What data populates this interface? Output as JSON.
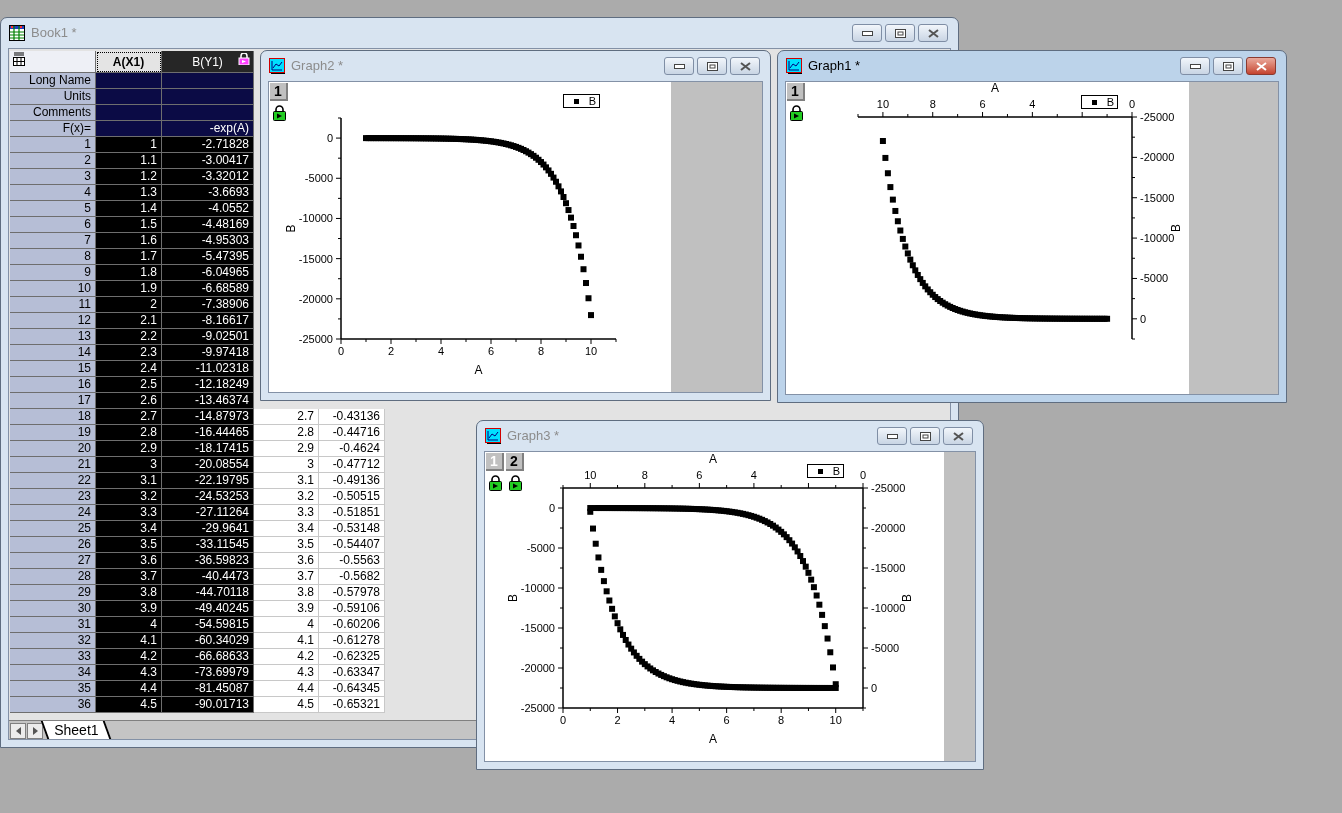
{
  "windows": [
    {
      "kind": "workbook",
      "title": "Book1 *",
      "active": false,
      "columns": [
        {
          "label": "A(X1)",
          "selected": true,
          "focused": true,
          "locked": false
        },
        {
          "label": "B(Y1)",
          "selected": true,
          "focused": false,
          "locked": true
        }
      ],
      "label_rows": [
        {
          "label": "Long Name"
        },
        {
          "label": "Units"
        },
        {
          "label": "Comments"
        },
        {
          "label": "F(x)=",
          "column_2": "-exp(A)"
        }
      ],
      "rows": [
        {
          "n": "1",
          "a": "1",
          "b": "-2.71828"
        },
        {
          "n": "2",
          "a": "1.1",
          "b": "-3.00417"
        },
        {
          "n": "3",
          "a": "1.2",
          "b": "-3.32012"
        },
        {
          "n": "4",
          "a": "1.3",
          "b": "-3.6693"
        },
        {
          "n": "5",
          "a": "1.4",
          "b": "-4.0552"
        },
        {
          "n": "6",
          "a": "1.5",
          "b": "-4.48169"
        },
        {
          "n": "7",
          "a": "1.6",
          "b": "-4.95303"
        },
        {
          "n": "8",
          "a": "1.7",
          "b": "-5.47395"
        },
        {
          "n": "9",
          "a": "1.8",
          "b": "-6.04965"
        },
        {
          "n": "10",
          "a": "1.9",
          "b": "-6.68589"
        },
        {
          "n": "11",
          "a": "2",
          "b": "-7.38906"
        },
        {
          "n": "12",
          "a": "2.1",
          "b": "-8.16617"
        },
        {
          "n": "13",
          "a": "2.2",
          "b": "-9.02501"
        },
        {
          "n": "14",
          "a": "2.3",
          "b": "-9.97418"
        },
        {
          "n": "15",
          "a": "2.4",
          "b": "-11.02318"
        },
        {
          "n": "16",
          "a": "2.5",
          "b": "-12.18249"
        },
        {
          "n": "17",
          "a": "2.6",
          "b": "-13.46374"
        },
        {
          "n": "18",
          "a": "2.7",
          "b": "-14.87973",
          "column_3": "2.7",
          "column_4": "-0.43136"
        },
        {
          "n": "19",
          "a": "2.8",
          "b": "-16.44465",
          "column_3": "2.8",
          "column_4": "-0.44716"
        },
        {
          "n": "20",
          "a": "2.9",
          "b": "-18.17415",
          "column_3": "2.9",
          "column_4": "-0.4624"
        },
        {
          "n": "21",
          "a": "3",
          "b": "-20.08554",
          "column_3": "3",
          "column_4": "-0.47712"
        },
        {
          "n": "22",
          "a": "3.1",
          "b": "-22.19795",
          "column_3": "3.1",
          "column_4": "-0.49136"
        },
        {
          "n": "23",
          "a": "3.2",
          "b": "-24.53253",
          "column_3": "3.2",
          "column_4": "-0.50515"
        },
        {
          "n": "24",
          "a": "3.3",
          "b": "-27.11264",
          "column_3": "3.3",
          "column_4": "-0.51851"
        },
        {
          "n": "25",
          "a": "3.4",
          "b": "-29.9641",
          "column_3": "3.4",
          "column_4": "-0.53148"
        },
        {
          "n": "26",
          "a": "3.5",
          "b": "-33.11545",
          "column_3": "3.5",
          "column_4": "-0.54407"
        },
        {
          "n": "27",
          "a": "3.6",
          "b": "-36.59823",
          "column_3": "3.6",
          "column_4": "-0.5563"
        },
        {
          "n": "28",
          "a": "3.7",
          "b": "-40.4473",
          "column_3": "3.7",
          "column_4": "-0.5682"
        },
        {
          "n": "29",
          "a": "3.8",
          "b": "-44.70118",
          "column_3": "3.8",
          "column_4": "-0.57978"
        },
        {
          "n": "30",
          "a": "3.9",
          "b": "-49.40245",
          "column_3": "3.9",
          "column_4": "-0.59106"
        },
        {
          "n": "31",
          "a": "4",
          "b": "-54.59815",
          "column_3": "4",
          "column_4": "-0.60206"
        },
        {
          "n": "32",
          "a": "4.1",
          "b": "-60.34029",
          "column_3": "4.1",
          "column_4": "-0.61278"
        },
        {
          "n": "33",
          "a": "4.2",
          "b": "-66.68633",
          "column_3": "4.2",
          "column_4": "-0.62325"
        },
        {
          "n": "34",
          "a": "4.3",
          "b": "-73.69979",
          "column_3": "4.3",
          "column_4": "-0.63347"
        },
        {
          "n": "35",
          "a": "4.4",
          "b": "-81.45087",
          "column_3": "4.4",
          "column_4": "-0.64345"
        },
        {
          "n": "36",
          "a": "4.5",
          "b": "-90.01713",
          "column_3": "4.5",
          "column_4": "-0.65321"
        }
      ],
      "sheet_tabs": [
        {
          "label": "Sheet1",
          "selected": true
        }
      ]
    },
    {
      "kind": "graph",
      "title": "Graph2 *",
      "active": false,
      "layers": [
        {
          "label": "1",
          "selected": true,
          "kind": "standard",
          "chart_data": {
            "type": "scatter",
            "xlabel": "A",
            "ylabel": "B",
            "x": [
              1,
              1.1,
              1.2,
              1.3,
              1.4,
              1.5,
              1.6,
              1.7,
              1.8,
              1.9,
              2,
              2.1,
              2.2,
              2.3,
              2.4,
              2.5,
              2.6,
              2.7,
              2.8,
              2.9,
              3,
              3.1,
              3.2,
              3.3,
              3.4,
              3.5,
              3.6,
              3.7,
              3.8,
              3.9,
              4,
              4.1,
              4.2,
              4.3,
              4.4,
              4.5,
              4.6,
              4.7,
              4.8,
              4.9,
              5,
              5.1,
              5.2,
              5.3,
              5.4,
              5.5,
              5.6,
              5.7,
              5.8,
              5.9,
              6,
              6.1,
              6.2,
              6.3,
              6.4,
              6.5,
              6.6,
              6.7,
              6.8,
              6.9,
              7,
              7.1,
              7.2,
              7.3,
              7.4,
              7.5,
              7.6,
              7.7,
              7.8,
              7.9,
              8,
              8.1,
              8.2,
              8.3,
              8.4,
              8.5,
              8.6,
              8.7,
              8.8,
              8.9,
              9,
              9.1,
              9.2,
              9.3,
              9.4,
              9.5,
              9.6,
              9.7,
              9.8,
              9.9,
              10
            ],
            "series": [
              {
                "name": "B",
                "color": "#000000",
                "values": [
                  -3,
                  -3,
                  -3,
                  -4,
                  -4,
                  -4,
                  -5,
                  -5,
                  -6,
                  -7,
                  -7,
                  -8,
                  -9,
                  -10,
                  -11,
                  -12,
                  -13,
                  -15,
                  -16,
                  -18,
                  -20,
                  -22,
                  -25,
                  -27,
                  -30,
                  -33,
                  -37,
                  -40,
                  -45,
                  -49,
                  -55,
                  -60,
                  -67,
                  -74,
                  -81,
                  -90,
                  -99,
                  -110,
                  -122,
                  -134,
                  -148,
                  -164,
                  -181,
                  -200,
                  -221,
                  -245,
                  -270,
                  -299,
                  -330,
                  -365,
                  -403,
                  -446,
                  -493,
                  -545,
                  -602,
                  -665,
                  -735,
                  -812,
                  -898,
                  -992,
                  -1097,
                  -1212,
                  -1339,
                  -1480,
                  -1636,
                  -1808,
                  -1998,
                  -2208,
                  -2441,
                  -2697,
                  -2981,
                  -3294,
                  -3641,
                  -4024,
                  -4447,
                  -4915,
                  -5432,
                  -6003,
                  -6634,
                  -7332,
                  -8103,
                  -8955,
                  -9897,
                  -10938,
                  -12088,
                  -13360,
                  -14765,
                  -16318,
                  -18034,
                  -19930,
                  -22026
                ]
              }
            ],
            "xlim": [
              0,
              11
            ],
            "ylim": [
              -25000,
              2500
            ],
            "xticks": [
              {
                "value": 0,
                "label": "0"
              },
              {
                "value": 2,
                "label": "2"
              },
              {
                "value": 4,
                "label": "4"
              },
              {
                "value": 6,
                "label": "6"
              },
              {
                "value": 8,
                "label": "8"
              },
              {
                "value": 10,
                "label": "10"
              }
            ],
            "yticks": [
              {
                "value": -25000,
                "label": "-25000"
              },
              {
                "value": -20000,
                "label": "-20000"
              },
              {
                "value": -15000,
                "label": "-15000"
              },
              {
                "value": -10000,
                "label": "-10000"
              },
              {
                "value": -5000,
                "label": "-5000"
              },
              {
                "value": 0,
                "label": "0"
              }
            ]
          }
        }
      ]
    },
    {
      "kind": "graph",
      "title": "Graph1 *",
      "active": true,
      "layers": [
        {
          "label": "1",
          "selected": true,
          "kind": "reversed",
          "chart_data": {
            "type": "scatter",
            "xlabel": "A",
            "ylabel": "B",
            "x": [
              1,
              1.1,
              1.2,
              1.3,
              1.4,
              1.5,
              1.6,
              1.7,
              1.8,
              1.9,
              2,
              2.1,
              2.2,
              2.3,
              2.4,
              2.5,
              2.6,
              2.7,
              2.8,
              2.9,
              3,
              3.1,
              3.2,
              3.3,
              3.4,
              3.5,
              3.6,
              3.7,
              3.8,
              3.9,
              4,
              4.1,
              4.2,
              4.3,
              4.4,
              4.5,
              4.6,
              4.7,
              4.8,
              4.9,
              5,
              5.1,
              5.2,
              5.3,
              5.4,
              5.5,
              5.6,
              5.7,
              5.8,
              5.9,
              6,
              6.1,
              6.2,
              6.3,
              6.4,
              6.5,
              6.6,
              6.7,
              6.8,
              6.9,
              7,
              7.1,
              7.2,
              7.3,
              7.4,
              7.5,
              7.6,
              7.7,
              7.8,
              7.9,
              8,
              8.1,
              8.2,
              8.3,
              8.4,
              8.5,
              8.6,
              8.7,
              8.8,
              8.9,
              9,
              9.1,
              9.2,
              9.3,
              9.4,
              9.5,
              9.6,
              9.7,
              9.8,
              9.9,
              10
            ],
            "series": [
              {
                "name": "B",
                "color": "#000000",
                "values": [
                  -3,
                  -3,
                  -3,
                  -4,
                  -4,
                  -4,
                  -5,
                  -5,
                  -6,
                  -7,
                  -7,
                  -8,
                  -9,
                  -10,
                  -11,
                  -12,
                  -13,
                  -15,
                  -16,
                  -18,
                  -20,
                  -22,
                  -25,
                  -27,
                  -30,
                  -33,
                  -37,
                  -40,
                  -45,
                  -49,
                  -55,
                  -60,
                  -67,
                  -74,
                  -81,
                  -90,
                  -99,
                  -110,
                  -122,
                  -134,
                  -148,
                  -164,
                  -181,
                  -200,
                  -221,
                  -245,
                  -270,
                  -299,
                  -330,
                  -365,
                  -403,
                  -446,
                  -493,
                  -545,
                  -602,
                  -665,
                  -735,
                  -812,
                  -898,
                  -992,
                  -1097,
                  -1212,
                  -1339,
                  -1480,
                  -1636,
                  -1808,
                  -1998,
                  -2208,
                  -2441,
                  -2697,
                  -2981,
                  -3294,
                  -3641,
                  -4024,
                  -4447,
                  -4915,
                  -5432,
                  -6003,
                  -6634,
                  -7332,
                  -8103,
                  -8955,
                  -9897,
                  -10938,
                  -12088,
                  -13360,
                  -14765,
                  -16318,
                  -18034,
                  -19930,
                  -22026
                ]
              }
            ],
            "xlim": [
              11,
              0
            ],
            "ylim": [
              2500,
              -25000
            ],
            "xticks": [
              {
                "value": 10,
                "label": "10"
              },
              {
                "value": 8,
                "label": "8"
              },
              {
                "value": 6,
                "label": "6"
              },
              {
                "value": 4,
                "label": "4"
              },
              {
                "value": 0,
                "label": "0"
              }
            ],
            "yticks": [
              {
                "value": -25000,
                "label": "-25000"
              },
              {
                "value": -20000,
                "label": "-20000"
              },
              {
                "value": -15000,
                "label": "-15000"
              },
              {
                "value": -10000,
                "label": "-10000"
              },
              {
                "value": -5000,
                "label": "-5000"
              },
              {
                "value": 0,
                "label": "0"
              }
            ]
          }
        }
      ]
    },
    {
      "kind": "graph",
      "title": "Graph3 *",
      "active": false,
      "layers": [
        {
          "label": "1",
          "selected": false,
          "kind": "standard",
          "chart_data": {
            "type": "scatter",
            "xlabel": "A",
            "ylabel": "B",
            "x": [
              1,
              1.2,
              1.3,
              1.4,
              1.5,
              1.6,
              1.7,
              1.8,
              1.9,
              2,
              2.1,
              2.2,
              2.3,
              2.4,
              2.5,
              2.6,
              2.7,
              2.8,
              2.9,
              3,
              3.1,
              3.2,
              3.3,
              3.4,
              3.5,
              3.6,
              3.7,
              3.8,
              3.9,
              4,
              4.1,
              4.2,
              4.3,
              4.4,
              4.5,
              4.6,
              4.7,
              4.8,
              4.9,
              5,
              5.1,
              5.2,
              5.3,
              5.4,
              5.5,
              5.6,
              5.7,
              5.8,
              5.9,
              6,
              6.1,
              6.2,
              6.3,
              6.4,
              6.5,
              6.6,
              6.7,
              6.8,
              6.9,
              7,
              7.1,
              7.2,
              7.3,
              7.4,
              7.5,
              7.6,
              7.7,
              7.8,
              7.9,
              8,
              8.1,
              8.2,
              8.3,
              8.4,
              8.5,
              8.6,
              8.7,
              8.8,
              8.9,
              9,
              9.1,
              9.2,
              9.3,
              9.4,
              9.5,
              9.6,
              9.7,
              9.8,
              9.9,
              10
            ],
            "series": [
              {
                "name": "B",
                "color": "#000000",
                "values": [
                  -3,
                  -3,
                  -4,
                  -4,
                  -4,
                  -5,
                  -5,
                  -6,
                  -7,
                  -7,
                  -8,
                  -9,
                  -10,
                  -11,
                  -12,
                  -13,
                  -15,
                  -16,
                  -18,
                  -20,
                  -22,
                  -25,
                  -27,
                  -30,
                  -33,
                  -37,
                  -40,
                  -45,
                  -49,
                  -55,
                  -60,
                  -67,
                  -74,
                  -81,
                  -90,
                  -99,
                  -110,
                  -122,
                  -134,
                  -148,
                  -164,
                  -181,
                  -200,
                  -221,
                  -245,
                  -270,
                  -299,
                  -330,
                  -365,
                  -403,
                  -446,
                  -493,
                  -545,
                  -602,
                  -665,
                  -735,
                  -812,
                  -898,
                  -992,
                  -1097,
                  -1212,
                  -1339,
                  -1480,
                  -1636,
                  -1808,
                  -1998,
                  -2208,
                  -2441,
                  -2697,
                  -2981,
                  -3294,
                  -3641,
                  -4024,
                  -4447,
                  -4915,
                  -5432,
                  -6003,
                  -6634,
                  -7332,
                  -8103,
                  -8955,
                  -9897,
                  -10938,
                  -12088,
                  -13360,
                  -14765,
                  -16318,
                  -18034,
                  -19930,
                  -22026
                ]
              }
            ],
            "xlim": [
              0,
              11
            ],
            "ylim": [
              -25000,
              2500
            ],
            "xticks": [
              {
                "value": 0,
                "label": "0"
              },
              {
                "value": 2,
                "label": "2"
              },
              {
                "value": 4,
                "label": "4"
              },
              {
                "value": 6,
                "label": "6"
              },
              {
                "value": 8,
                "label": "8"
              },
              {
                "value": 10,
                "label": "10"
              }
            ],
            "yticks": [
              {
                "value": -25000,
                "label": "-25000"
              },
              {
                "value": -20000,
                "label": "-20000"
              },
              {
                "value": -15000,
                "label": "-15000"
              },
              {
                "value": -10000,
                "label": "-10000"
              },
              {
                "value": -5000,
                "label": "-5000"
              },
              {
                "value": 0,
                "label": "0"
              }
            ]
          }
        },
        {
          "label": "2",
          "selected": true,
          "kind": "reversed",
          "chart_data": {
            "type": "scatter",
            "xlabel": "A",
            "ylabel": "B",
            "x": [
              1,
              1.2,
              1.3,
              1.4,
              1.5,
              1.6,
              1.7,
              1.8,
              1.9,
              2,
              2.1,
              2.2,
              2.3,
              2.4,
              2.5,
              2.6,
              2.7,
              2.8,
              2.9,
              3,
              3.1,
              3.2,
              3.3,
              3.4,
              3.5,
              3.6,
              3.7,
              3.8,
              3.9,
              4,
              4.1,
              4.2,
              4.3,
              4.4,
              4.5,
              4.6,
              4.7,
              4.8,
              4.9,
              5,
              5.1,
              5.2,
              5.3,
              5.4,
              5.5,
              5.6,
              5.7,
              5.8,
              5.9,
              6,
              6.1,
              6.2,
              6.3,
              6.4,
              6.5,
              6.6,
              6.7,
              6.8,
              6.9,
              7,
              7.1,
              7.2,
              7.3,
              7.4,
              7.5,
              7.6,
              7.7,
              7.8,
              7.9,
              8,
              8.1,
              8.2,
              8.3,
              8.4,
              8.5,
              8.6,
              8.7,
              8.8,
              8.9,
              9,
              9.1,
              9.2,
              9.3,
              9.4,
              9.5,
              9.6,
              9.7,
              9.8,
              9.9,
              10
            ],
            "series": [
              {
                "color": "#000000",
                "values": [
                  -3,
                  -3,
                  -4,
                  -4,
                  -4,
                  -5,
                  -5,
                  -6,
                  -7,
                  -7,
                  -8,
                  -9,
                  -10,
                  -11,
                  -12,
                  -13,
                  -15,
                  -16,
                  -18,
                  -20,
                  -22,
                  -25,
                  -27,
                  -30,
                  -33,
                  -37,
                  -40,
                  -45,
                  -49,
                  -55,
                  -60,
                  -67,
                  -74,
                  -81,
                  -90,
                  -99,
                  -110,
                  -122,
                  -134,
                  -148,
                  -164,
                  -181,
                  -200,
                  -221,
                  -245,
                  -270,
                  -299,
                  -330,
                  -365,
                  -403,
                  -446,
                  -493,
                  -545,
                  -602,
                  -665,
                  -735,
                  -812,
                  -898,
                  -992,
                  -1097,
                  -1212,
                  -1339,
                  -1480,
                  -1636,
                  -1808,
                  -1998,
                  -2208,
                  -2441,
                  -2697,
                  -2981,
                  -3294,
                  -3641,
                  -4024,
                  -4447,
                  -4915,
                  -5432,
                  -6003,
                  -6634,
                  -7332,
                  -8103,
                  -8955,
                  -9897,
                  -10938,
                  -12088,
                  -13360,
                  -14765,
                  -16318,
                  -18034,
                  -19930,
                  -22026
                ]
              }
            ],
            "xlim": [
              11,
              0
            ],
            "ylim": [
              2500,
              -25000
            ],
            "xticks": [
              {
                "value": 10,
                "label": "10"
              },
              {
                "value": 8,
                "label": "8"
              },
              {
                "value": 6,
                "label": "6"
              },
              {
                "value": 4,
                "label": "4"
              },
              {
                "value": 0,
                "label": "0"
              }
            ],
            "yticks": [
              {
                "value": -25000,
                "label": "-25000"
              },
              {
                "value": -20000,
                "label": "-20000"
              },
              {
                "value": -15000,
                "label": "-15000"
              },
              {
                "value": -10000,
                "label": "-10000"
              },
              {
                "value": -5000,
                "label": "-5000"
              },
              {
                "value": 0,
                "label": "0"
              }
            ]
          }
        }
      ]
    }
  ]
}
